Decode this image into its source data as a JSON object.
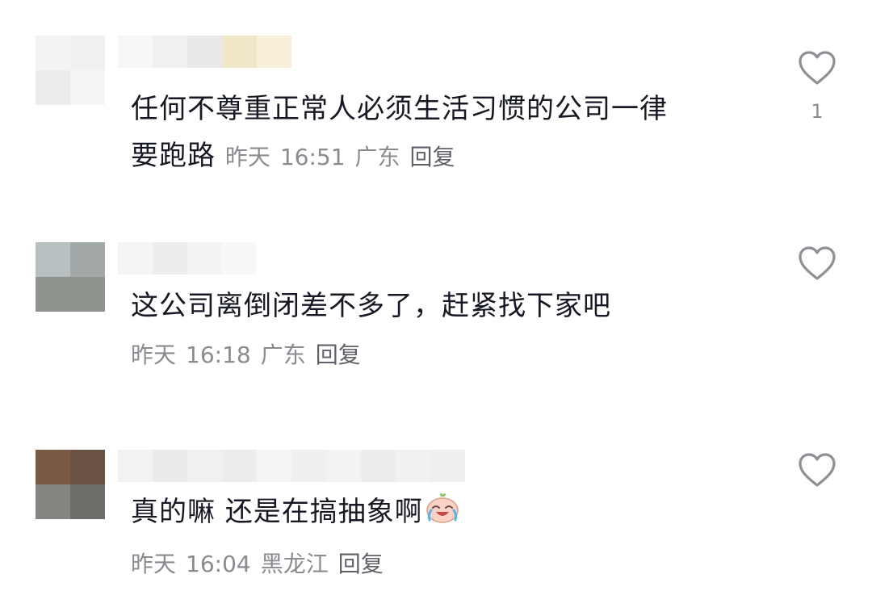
{
  "comments": [
    {
      "avatar_colors": [
        "#f3f3f3",
        "#f0f0f0",
        "#ececec",
        "#f5f5f5"
      ],
      "name_colors": [
        "#f7f7f7",
        "#f1f1f1",
        "#e9e9e9",
        "#f0e6c8",
        "#f8efd8"
      ],
      "text": "任何不尊重正常人必须生活习惯的公司一律要跑路",
      "text_line1": "任何不尊重正常人必须生活习惯的公司一律",
      "text_line2": "要跑路",
      "date": "昨天",
      "time": "16:51",
      "location": "广东",
      "reply_label": "回复",
      "like_count": "1"
    },
    {
      "avatar_colors": [
        "#b9c0c2",
        "#a2a9a8",
        "#8e928c",
        "#8f938d"
      ],
      "name_colors": [
        "#f5f5f5",
        "#ededed",
        "#f3f3f3",
        "#f8f8f8"
      ],
      "text": "这公司离倒闭差不多了，赶紧找下家吧",
      "date": "昨天",
      "time": "16:18",
      "location": "广东",
      "reply_label": "回复",
      "like_count": ""
    },
    {
      "avatar_colors": [
        "#7b5a45",
        "#6a5344",
        "#828580",
        "#6c6e6a"
      ],
      "name_colors": [
        "#f2f2f2",
        "#eaeaea",
        "#f0f0f0",
        "#ececec",
        "#f4f4f4",
        "#efefef",
        "#f3f3f3",
        "#ededed",
        "#f1f1f1",
        "#eeeeee"
      ],
      "text": "真的嘛 还是在搞抽象啊",
      "emoji": "cry-laugh-emoji",
      "date": "昨天",
      "time": "16:04",
      "location": "黑龙江",
      "reply_label": "回复",
      "like_count": ""
    }
  ],
  "icons": {
    "like": "heart-outline-icon"
  }
}
